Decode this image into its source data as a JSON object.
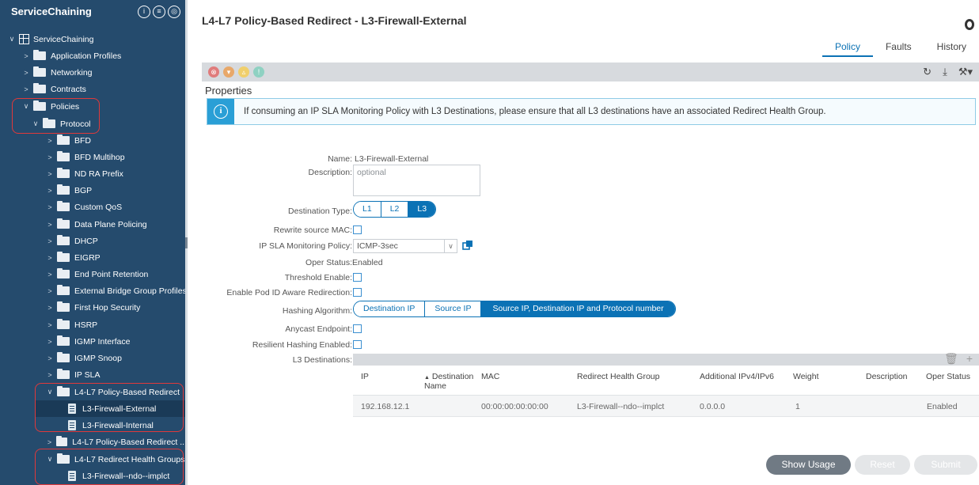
{
  "sidebar": {
    "title": "ServiceChaining",
    "header_icons": [
      "info-circle-icon",
      "list-circle-icon",
      "refresh-circle-icon"
    ],
    "items": [
      {
        "label": "ServiceChaining",
        "chev": "v",
        "icon": "tenant-icon"
      },
      {
        "label": "Application Profiles",
        "chev": ">",
        "icon": "folder-icon"
      },
      {
        "label": "Networking",
        "chev": ">",
        "icon": "folder-icon"
      },
      {
        "label": "Contracts",
        "chev": ">",
        "icon": "folder-icon"
      },
      {
        "label": "Policies",
        "chev": "v",
        "icon": "folder-icon"
      },
      {
        "label": "Protocol",
        "chev": "v",
        "icon": "folder-icon"
      },
      {
        "label": "BFD",
        "chev": ">",
        "icon": "folder-icon"
      },
      {
        "label": "BFD Multihop",
        "chev": ">",
        "icon": "folder-icon"
      },
      {
        "label": "ND RA Prefix",
        "chev": ">",
        "icon": "folder-icon"
      },
      {
        "label": "BGP",
        "chev": ">",
        "icon": "folder-icon"
      },
      {
        "label": "Custom QoS",
        "chev": ">",
        "icon": "folder-icon"
      },
      {
        "label": "Data Plane Policing",
        "chev": ">",
        "icon": "folder-icon"
      },
      {
        "label": "DHCP",
        "chev": ">",
        "icon": "folder-icon"
      },
      {
        "label": "EIGRP",
        "chev": ">",
        "icon": "folder-icon"
      },
      {
        "label": "End Point Retention",
        "chev": ">",
        "icon": "folder-icon"
      },
      {
        "label": "External Bridge Group Profiles",
        "chev": ">",
        "icon": "folder-icon"
      },
      {
        "label": "First Hop Security",
        "chev": ">",
        "icon": "folder-icon"
      },
      {
        "label": "HSRP",
        "chev": ">",
        "icon": "folder-icon"
      },
      {
        "label": "IGMP Interface",
        "chev": ">",
        "icon": "folder-icon"
      },
      {
        "label": "IGMP Snoop",
        "chev": ">",
        "icon": "folder-icon"
      },
      {
        "label": "IP SLA",
        "chev": ">",
        "icon": "folder-icon"
      },
      {
        "label": "L4-L7 Policy-Based Redirect",
        "chev": "v",
        "icon": "folder-icon"
      },
      {
        "label": "L3-Firewall-External",
        "chev": "",
        "icon": "document-icon"
      },
      {
        "label": "L3-Firewall-Internal",
        "chev": "",
        "icon": "document-icon"
      },
      {
        "label": "L4-L7 Policy-Based Redirect ...",
        "chev": ">",
        "icon": "folder-icon"
      },
      {
        "label": "L4-L7 Redirect Health Groups",
        "chev": "v",
        "icon": "folder-icon"
      },
      {
        "label": "L3-Firewall--ndo--implct",
        "chev": "",
        "icon": "document-icon"
      }
    ]
  },
  "header": {
    "title": "L4-L7 Policy-Based Redirect - L3-Firewall-External",
    "tabs": [
      "Policy",
      "Faults",
      "History"
    ]
  },
  "section_label": "Properties",
  "alert_text": "If consuming an IP SLA Monitoring Policy with L3 Destinations, please ensure that all L3 destinations have an associated Redirect Health Group.",
  "form": {
    "name_label": "Name:",
    "name_value": "L3-Firewall-External",
    "description_label": "Description:",
    "description_placeholder": "optional",
    "destination_type_label": "Destination Type:",
    "destination_types": [
      "L1",
      "L2",
      "L3"
    ],
    "rewrite_mac_label": "Rewrite source MAC:",
    "ip_sla_label": "IP SLA Monitoring Policy:",
    "ip_sla_value": "ICMP-3sec",
    "oper_status_label": "Oper Status:",
    "oper_status_value": "Enabled",
    "threshold_label": "Threshold Enable:",
    "pod_id_label": "Enable Pod ID Aware Redirection:",
    "hashing_label": "Hashing Algorithm:",
    "hashing_options": [
      "Destination IP",
      "Source IP",
      "Source IP, Destination IP and Protocol number"
    ],
    "anycast_label": "Anycast Endpoint:",
    "resilient_label": "Resilient Hashing Enabled:",
    "l3dest_label": "L3 Destinations:"
  },
  "table": {
    "columns": [
      "IP",
      "Destination Name",
      "MAC",
      "Redirect Health Group",
      "Additional IPv4/IPv6",
      "Weight",
      "Description",
      "Oper Status"
    ],
    "sort_indicator": "▲",
    "rows": [
      [
        "192.168.12.1",
        "",
        "00:00:00:00:00:00",
        "L3-Firewall--ndo--implct",
        "0.0.0.0",
        "1",
        "",
        "Enabled"
      ]
    ]
  },
  "buttons": {
    "show_usage": "Show Usage",
    "reset": "Reset",
    "submit": "Submit"
  },
  "colors": {
    "sidebar_bg": "#254b6d",
    "accent": "#0b72b5",
    "highlight_box": "#e0393b",
    "fault_critical": "#e07c7c",
    "fault_major": "#e8a86a",
    "fault_minor": "#f0cf6c",
    "fault_warning": "#8fd1c2"
  }
}
